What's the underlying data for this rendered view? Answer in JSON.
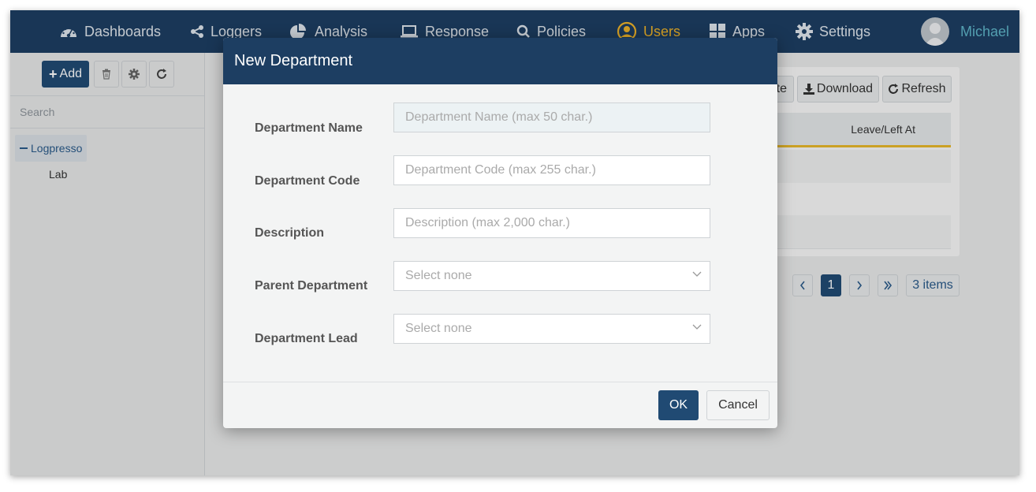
{
  "nav": {
    "items": [
      {
        "label": "Dashboards",
        "icon": "dashboard-gauge-icon"
      },
      {
        "label": "Loggers",
        "icon": "share-nodes-icon"
      },
      {
        "label": "Analysis",
        "icon": "pie-chart-icon"
      },
      {
        "label": "Response",
        "icon": "laptop-icon"
      },
      {
        "label": "Policies",
        "icon": "search-icon"
      },
      {
        "label": "Users",
        "icon": "user-circle-icon",
        "active": true
      },
      {
        "label": "Apps",
        "icon": "grid-icon"
      },
      {
        "label": "Settings",
        "icon": "gear-icon"
      }
    ],
    "user_name": "Michael",
    "active_color": "#f0b429"
  },
  "sidebar": {
    "add_label": "Add",
    "search_placeholder": "Search",
    "tree": {
      "root": "Logpresso",
      "children": [
        "Lab"
      ]
    }
  },
  "content": {
    "partial_button": "te",
    "download_label": "Download",
    "refresh_label": "Refresh",
    "column_header": "Leave/Left At",
    "pagination": {
      "current_page": "1",
      "items_count": "3 items"
    }
  },
  "modal": {
    "title": "New Department",
    "fields": [
      {
        "label": "Department Name",
        "placeholder": "Department Name (max 50 char.)"
      },
      {
        "label": "Department Code",
        "placeholder": "Department Code (max 255 char.)"
      },
      {
        "label": "Description",
        "placeholder": "Description (max 2,000 char.)"
      },
      {
        "label": "Parent Department",
        "placeholder": "Select none"
      },
      {
        "label": "Department Lead",
        "placeholder": "Select none"
      }
    ],
    "ok_label": "OK",
    "cancel_label": "Cancel"
  },
  "colors": {
    "header_bg": "#1d3e62",
    "primary_btn": "#204a73",
    "accent_underline": "#e8b829",
    "user_name": "#5fb5c9"
  }
}
